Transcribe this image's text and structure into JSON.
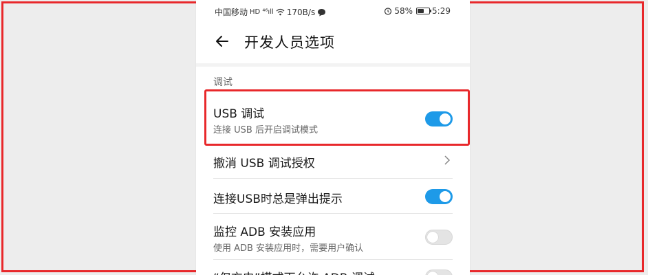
{
  "status_bar": {
    "carrier": "中国移动",
    "network_badges": "HD ⁴⁶ıll",
    "speed": "170B/s",
    "battery": "58%",
    "battery_level": 0.58,
    "time": "5:29"
  },
  "header": {
    "title": "开发人员选项"
  },
  "section": {
    "label": "调试"
  },
  "settings": [
    {
      "title": "USB 调试",
      "subtitle": "连接 USB 后开启调试模式",
      "control": "toggle",
      "state": "on"
    },
    {
      "title": "撤消 USB 调试授权",
      "control": "chevron"
    },
    {
      "title": "连接USB时总是弹出提示",
      "control": "toggle",
      "state": "on"
    },
    {
      "title": "监控 ADB 安装应用",
      "subtitle": "使用 ADB 安装应用时，需要用户确认",
      "control": "toggle",
      "state": "off"
    },
    {
      "title": "“仅充电”模式下允许 ADB 调试",
      "control": "toggle",
      "state": "off"
    }
  ],
  "colors": {
    "accent": "#1e9ae8",
    "highlight": "#e8282b",
    "toggle_off": "#e4e4e4"
  }
}
